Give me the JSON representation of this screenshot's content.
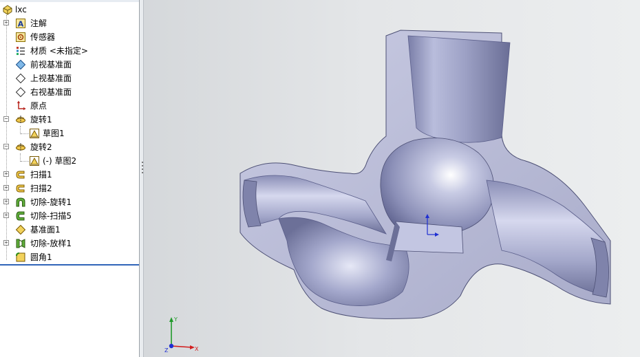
{
  "feature_tree": {
    "root": {
      "label": "lxc",
      "icon": "part-icon"
    },
    "items": [
      {
        "label": "注解",
        "icon": "annotations-icon",
        "expander": "+"
      },
      {
        "label": "传感器",
        "icon": "sensor-icon"
      },
      {
        "label": "材质 <未指定>",
        "icon": "material-icon"
      },
      {
        "label": "前视基准面",
        "icon": "plane-icon"
      },
      {
        "label": "上视基准面",
        "icon": "plane-icon"
      },
      {
        "label": "右视基准面",
        "icon": "plane-icon"
      },
      {
        "label": "原点",
        "icon": "origin-icon"
      },
      {
        "label": "旋转1",
        "icon": "revolve-icon",
        "expander": "−"
      },
      {
        "label": "草图1",
        "icon": "sketch-icon",
        "child": true
      },
      {
        "label": "旋转2",
        "icon": "revolve-icon",
        "expander": "−"
      },
      {
        "label": "(-) 草图2",
        "icon": "sketch-icon",
        "child": true
      },
      {
        "label": "扫描1",
        "icon": "sweep-icon",
        "expander": "+"
      },
      {
        "label": "扫描2",
        "icon": "sweep-icon",
        "expander": "+"
      },
      {
        "label": "切除-旋转1",
        "icon": "cut-revolve-icon",
        "expander": "+"
      },
      {
        "label": "切除-扫描5",
        "icon": "cut-sweep-icon",
        "expander": "+"
      },
      {
        "label": "基准面1",
        "icon": "ref-plane-icon"
      },
      {
        "label": "切除-放样1",
        "icon": "cut-loft-icon",
        "expander": "+"
      },
      {
        "label": "圆角1",
        "icon": "fillet-icon"
      }
    ]
  },
  "viewport": {
    "triad": {
      "x_label": "X",
      "y_label": "Y",
      "z_label": "Z"
    },
    "colors": {
      "model_light": "#d4d6ec",
      "model_mid": "#9ea2c6",
      "model_dark": "#5a5e8a",
      "x_axis": "#d21f1f",
      "y_axis": "#1f9a2a",
      "z_axis": "#1f2fd2"
    }
  }
}
